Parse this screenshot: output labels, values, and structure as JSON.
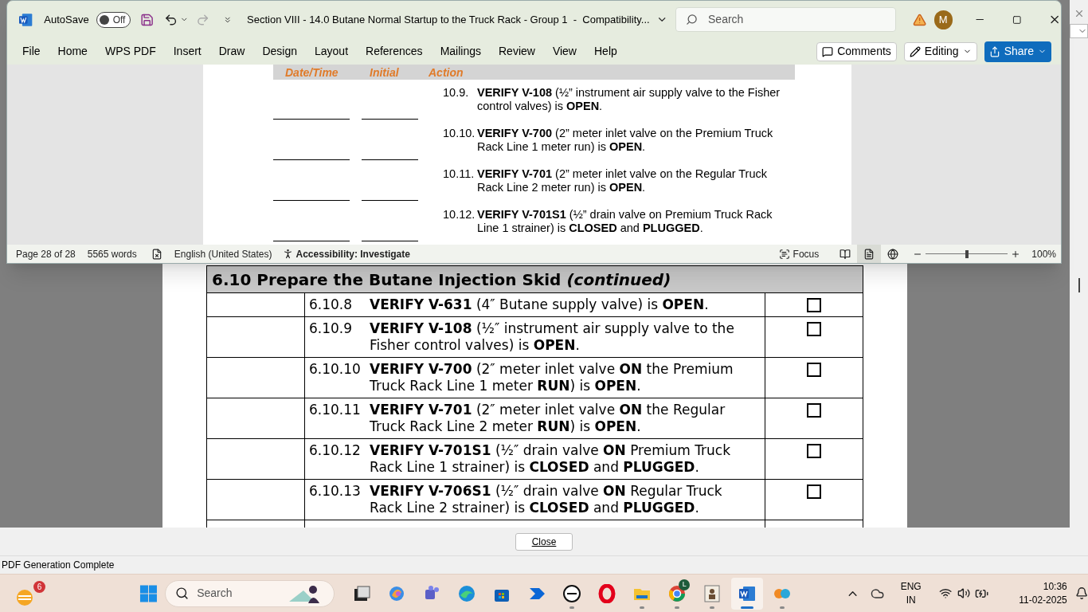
{
  "pdf_viewer": {
    "section_title": "6.10 Prepare the Butane Injection Skid",
    "section_suffix": "(continued)",
    "steps": [
      {
        "number": "6.10.8",
        "text": "**VERIFY V-631** (4″ Butane supply valve) is **OPEN**.",
        "checked": false
      },
      {
        "number": "6.10.9",
        "text": "**VERIFY V-108** (½″ instrument air supply valve to the Fisher control valves) is **OPEN**.",
        "checked": false
      },
      {
        "number": "6.10.10",
        "text": "**VERIFY V-700** (2″ meter inlet valve **ON** the Premium Truck Rack Line 1 meter **RUN**) is **OPEN**.",
        "checked": false
      },
      {
        "number": "6.10.11",
        "text": "**VERIFY V-701** (2″ meter inlet valve **ON** the Regular Truck Rack Line 2 meter **RUN**) is **OPEN**.",
        "checked": false
      },
      {
        "number": "6.10.12",
        "text": "**VERIFY V-701S1** (½″ drain valve **ON** Premium Truck Rack Line 1 strainer) is **CLOSED** and **PLUGGED**.",
        "checked": false
      },
      {
        "number": "6.10.13",
        "text": "**VERIFY V-706S1** (½″ drain valve **ON** Regular Truck Rack Line 2 strainer) is **CLOSED** and **PLUGGED**.",
        "checked": false
      }
    ],
    "close_button": "Close",
    "status": "PDF Generation Complete"
  },
  "word_window": {
    "autosave": {
      "label": "AutoSave",
      "toggle_text": "Off",
      "on": false
    },
    "redo": {
      "disabled": true
    },
    "title": "Section VIII - 14.0 Butane Normal Startup to the Truck Rack - Group 1  -  Compatibility...",
    "search": {
      "placeholder": "Search"
    },
    "account_initial": "M",
    "ribbon_tabs": [
      "File",
      "Home",
      "WPS PDF",
      "Insert",
      "Draw",
      "Design",
      "Layout",
      "References",
      "Mailings",
      "Review",
      "View",
      "Help"
    ],
    "comments": "Comments",
    "editing": "Editing",
    "share": "Share",
    "document": {
      "columns": [
        "Date/Time",
        "Initial",
        "Action"
      ],
      "steps": [
        {
          "number": "10.9.",
          "text": "**VERIFY V-108** (½” instrument air supply valve to the Fisher control valves) is **OPEN**."
        },
        {
          "number": "10.10.",
          "text": "**VERIFY V-700** (2” meter inlet valve on the Premium Truck Rack Line 1 meter run) is **OPEN**."
        },
        {
          "number": "10.11.",
          "text": "**VERIFY V-701** (2” meter inlet valve on the Regular Truck Rack Line 2 meter run) is **OPEN**."
        },
        {
          "number": "10.12.",
          "text": "**VERIFY V-701S1** (½” drain valve on Premium Truck Rack Line 1 strainer) is **CLOSED** and **PLUGGED**."
        }
      ]
    },
    "status_bar": {
      "page": "Page 28 of 28",
      "words": "5565 words",
      "language": "English (United States)",
      "accessibility": "Accessibility: Investigate",
      "focus": "Focus",
      "views": [
        {
          "selected": false
        },
        {
          "selected": true
        },
        {
          "selected": false
        }
      ],
      "zoom": {
        "level": 0.5,
        "reading": "100%"
      }
    }
  },
  "taskbar": {
    "widget_badge": "6",
    "search_placeholder": "Search",
    "apps": [
      {
        "running": false,
        "active": false
      },
      {
        "running": false,
        "active": false
      },
      {
        "running": false,
        "active": false
      },
      {
        "running": false,
        "active": false
      },
      {
        "running": false,
        "active": false
      },
      {
        "running": false,
        "active": false
      },
      {
        "running": true,
        "active": false
      },
      {
        "running": false,
        "active": false
      },
      {
        "running": true,
        "active": false
      },
      {
        "running": true,
        "active": false,
        "badge": "L"
      },
      {
        "running": true,
        "active": false
      },
      {
        "running": true,
        "active": true
      },
      {
        "running": true,
        "active": false
      }
    ],
    "language": "ENG",
    "region": "IN",
    "time": "10:36",
    "date": "11-02-2025"
  }
}
